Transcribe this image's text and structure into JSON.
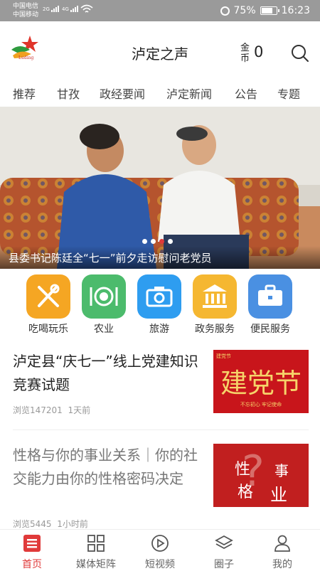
{
  "status_bar": {
    "carrier_1": "中国电信",
    "carrier_2": "中国移动",
    "net_1": "2G",
    "net_2": "4G",
    "battery": "75%",
    "battery_level": 0.75,
    "time": "16:23"
  },
  "header": {
    "logo_text": "Luding",
    "title": "泸定之声",
    "coin_label": "金币",
    "coin_value": "0"
  },
  "tabs": [
    {
      "label": "推荐",
      "active": true
    },
    {
      "label": "甘孜",
      "active": false
    },
    {
      "label": "政经要闻",
      "active": false
    },
    {
      "label": "泸定新闻",
      "active": false
    },
    {
      "label": "公告",
      "active": false
    },
    {
      "label": "专题",
      "active": false
    }
  ],
  "banner": {
    "caption": "县委书记陈廷全“七一”前夕走访慰问老党员",
    "slide_count": 4,
    "active_slide": 3
  },
  "quick_links": [
    {
      "label": "吃喝玩乐",
      "icon": "utensils-icon",
      "color": "#f5a623"
    },
    {
      "label": "农业",
      "icon": "plate-icon",
      "color": "#4cbb6c"
    },
    {
      "label": "旅游",
      "icon": "camera-icon",
      "color": "#2e9df0"
    },
    {
      "label": "政务服务",
      "icon": "government-building-icon",
      "color": "#f5b731"
    },
    {
      "label": "便民服务",
      "icon": "briefcase-icon",
      "color": "#4a90e2"
    }
  ],
  "articles": [
    {
      "title": "泸定县“庆七一”线上党建知识竞赛试题",
      "views": "浏览147201",
      "time": "1天前",
      "thumb_text": "建党节",
      "thumb_badge": "建党节",
      "thumb_footer": "不忘初心  牢记使命",
      "faded": false
    },
    {
      "title": "性格与你的事业关系｜你的社交能力由你的性格密码决定",
      "views": "浏览5445",
      "time": "1小时前",
      "thumb_chars": [
        "性",
        "格",
        "事",
        "业"
      ],
      "faded": true
    }
  ],
  "bottom_nav": [
    {
      "label": "首页",
      "icon": "home-icon",
      "active": true
    },
    {
      "label": "媒体矩阵",
      "icon": "grid-icon",
      "active": false
    },
    {
      "label": "短视频",
      "icon": "play-icon",
      "active": false
    },
    {
      "label": "圈子",
      "icon": "layers-icon",
      "active": false
    },
    {
      "label": "我的",
      "icon": "user-icon",
      "active": false
    }
  ],
  "colors": {
    "accent": "#e03a3a",
    "status_bar": "#9a9a9a"
  }
}
